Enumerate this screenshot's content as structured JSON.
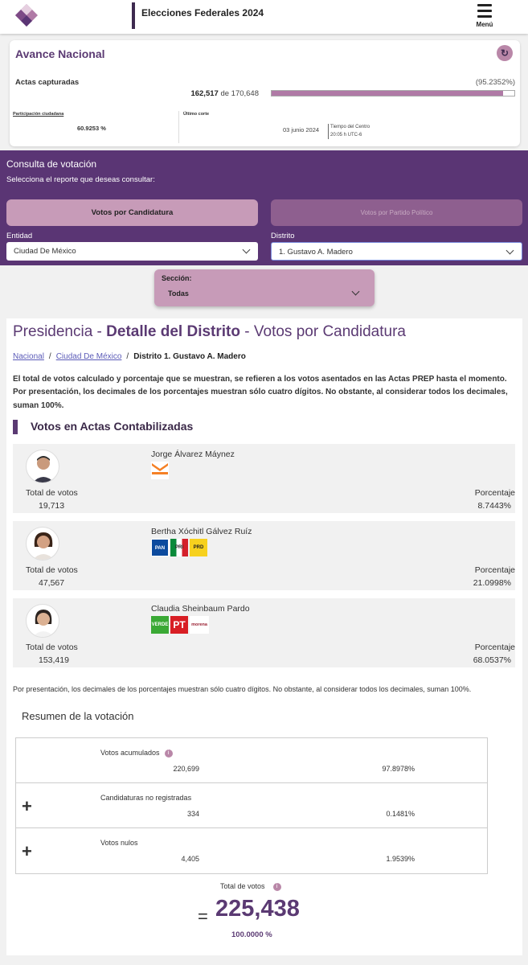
{
  "header": {
    "title": "Elecciones Federales 2024",
    "menu_label": "Menú"
  },
  "avance": {
    "title": "Avance Nacional",
    "actas_label": "Actas capturadas",
    "actas_captured": "162,517",
    "actas_of": "de",
    "actas_total": "170,648",
    "actas_pct": "(95.2352%)",
    "progress_fraction": 0.952352,
    "participacion_label": "Participación ciudadana",
    "participacion_value": "60.9253 %",
    "corte_label": "Último corte",
    "corte_date": "03 junio 2024",
    "corte_zone": "Tiempo del Centro",
    "corte_time": "20:05 h UTC-6"
  },
  "consulta": {
    "title": "Consulta de votación",
    "subtitle": "Selecciona el reporte que deseas consultar:",
    "btn_candidatura": "Votos por Candidatura",
    "btn_partido": "Votos por Partido Político",
    "entidad_label": "Entidad",
    "entidad_value": "Ciudad De México",
    "distrito_label": "Distrito",
    "distrito_value": "1. Gustavo A. Madero"
  },
  "seccion": {
    "label": "Sección:",
    "value": "Todas"
  },
  "main": {
    "title_a": "Presidencia - ",
    "title_b": "Detalle del Distrito",
    "title_c": " - Votos por Candidatura",
    "crumb_1": "Nacional",
    "crumb_2": "Ciudad De México",
    "crumb_3": "Distrito 1. Gustavo A. Madero",
    "crumb_sep": "/",
    "intro": "El total de votos calculado y porcentaje que se muestran, se refieren a los votos asentados en las Actas PREP hasta el momento. Por presentación, los decimales de los porcentajes muestran sólo cuatro dígitos. No obstante, al considerar todos los decimales, suman 100%.",
    "votos_heading": "Votos en Actas Contabilizadas",
    "total_label": "Total de votos",
    "pct_label": "Porcentaje"
  },
  "candidates": [
    {
      "name": "Jorge Álvarez Máynez",
      "votes": "19,713",
      "pct": "8.7443%",
      "parties": [
        "MC"
      ]
    },
    {
      "name": "Bertha Xóchitl Gálvez Ruíz",
      "votes": "47,567",
      "pct": "21.0998%",
      "parties": [
        "PAN",
        "PRI",
        "PRD"
      ]
    },
    {
      "name": "Claudia Sheinbaum Pardo",
      "votes": "153,419",
      "pct": "68.0537%",
      "parties": [
        "VERDE",
        "PT",
        "morena"
      ]
    }
  ],
  "footnote": "Por presentación, los decimales de los porcentajes muestran sólo cuatro dígitos. No obstante, al considerar todos los decimales, suman 100%.",
  "resumen": {
    "title": "Resumen de la votación",
    "rows": [
      {
        "label": "Votos acumulados",
        "value": "220,699",
        "pct": "97.8978%"
      },
      {
        "label": "Candidaturas no registradas",
        "value": "334",
        "pct": "0.1481%"
      },
      {
        "label": "Votos nulos",
        "value": "4,405",
        "pct": "1.9539%"
      }
    ],
    "total_label": "Total de votos",
    "total_eq": "=",
    "total_value": "225,438",
    "total_pct": "100.0000 %"
  },
  "colors": {
    "brand_purple": "#5a3574",
    "accent_pink": "#c79bb8"
  }
}
